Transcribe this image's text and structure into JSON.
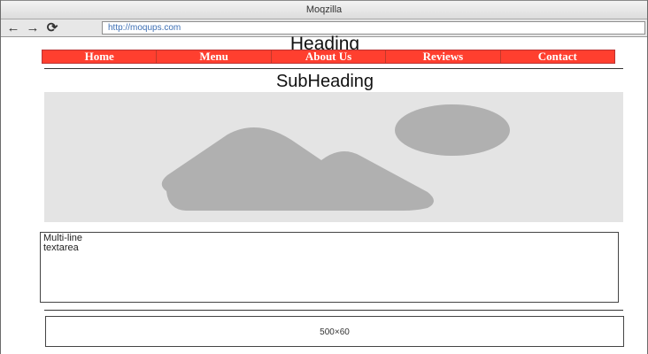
{
  "browser": {
    "title": "Moqzilla",
    "url": "http://moqups.com",
    "back_icon": "←",
    "forward_icon": "→",
    "reload_icon": "⟳"
  },
  "page": {
    "heading": "Heading",
    "menu": [
      {
        "label": "Home"
      },
      {
        "label": "Menu"
      },
      {
        "label": "About Us"
      },
      {
        "label": "Reviews"
      },
      {
        "label": "Contact"
      }
    ],
    "subheading": "SubHeading",
    "image_placeholder_icon": "image-icon",
    "textarea_text": "Multi-line\ntextarea",
    "box_label": "500×60"
  },
  "colors": {
    "menu_bg": "#ff3f2f",
    "placeholder_bg": "#e4e4e4",
    "placeholder_shapes": "#b0b0b0"
  }
}
